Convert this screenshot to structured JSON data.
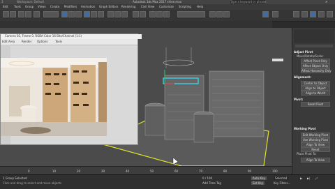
{
  "window": {
    "title": "Autodesk 3ds Max 2017   shine.max",
    "workspace": "Workspace: Default",
    "search_placeholder": "Type a keyword or phrase"
  },
  "menu": [
    "Edit",
    "Tools",
    "Group",
    "Views",
    "Create",
    "Modifiers",
    "Animation",
    "Graph Editors",
    "Rendering",
    "Civil View",
    "Customize",
    "Scripting",
    "Help"
  ],
  "render_window": {
    "title": "Camera 02, Frame 0, RGBA Color 16 Bits/Channel (1:1)",
    "menu": [
      "Render",
      "Options",
      "Tools"
    ],
    "area_label": "Edit Area"
  },
  "command_panel": {
    "sections": [
      {
        "header": "Adjust Pivot",
        "buttons": [
          "Affect Pivot Only",
          "Affect Object Only",
          "Affect Hierarchy Only"
        ],
        "sub": "Move/Rotate/Scale:"
      },
      {
        "header": "Alignment:",
        "buttons": [
          "Center to Object",
          "Align to Object",
          "Align to World"
        ]
      },
      {
        "header": "Pivot:",
        "buttons": [
          "Reset Pivot"
        ]
      },
      {
        "header": "Working Pivot",
        "buttons": [
          "Edit Working Pivot",
          "Use Working Pivot",
          "Align To View",
          "Reset"
        ],
        "sub": "Place Pivot To:"
      },
      {
        "header": "",
        "buttons": [
          "Align To View"
        ]
      }
    ]
  },
  "status": {
    "selection": "1 Group Selected",
    "hint": "Click and drag to select and move objects",
    "auto_key": "Auto Key",
    "set_key": "Set Key",
    "selected_label": "Selected",
    "key_filters": "Key Filters...",
    "frame": "0 / 100",
    "add_time_tag": "Add Time Tag"
  },
  "timeline_ticks": [
    "0",
    "10",
    "20",
    "30",
    "40",
    "50",
    "60",
    "70",
    "80",
    "90",
    "100"
  ],
  "colors": {
    "accent": "#3b6ea8",
    "viewport_border": "#e3e32a"
  }
}
